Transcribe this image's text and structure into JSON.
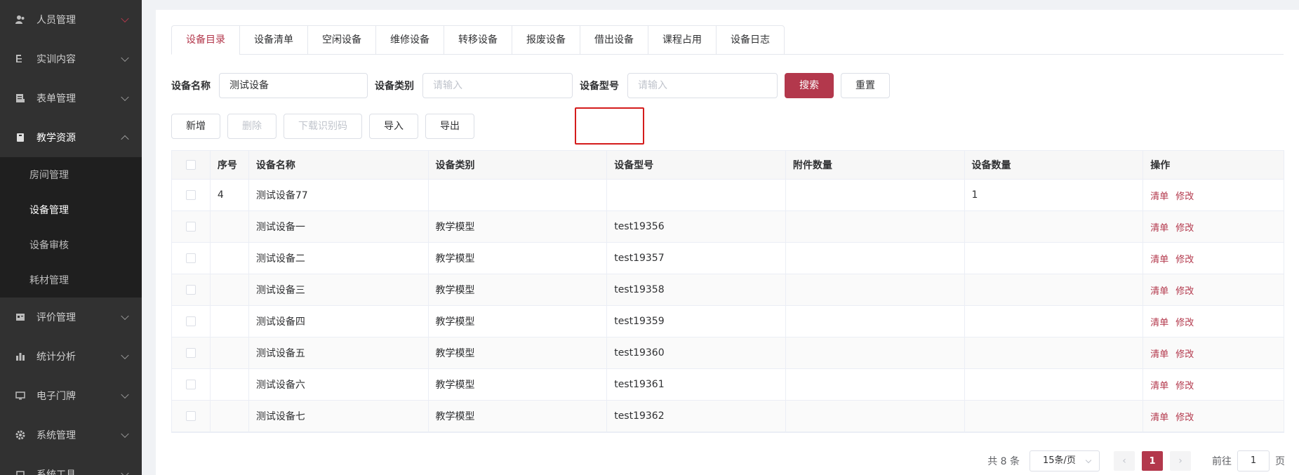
{
  "sidebar": {
    "items": [
      {
        "label": "人员管理",
        "icon": "users-icon"
      },
      {
        "label": "实训内容",
        "icon": "list-icon"
      },
      {
        "label": "表单管理",
        "icon": "form-icon"
      },
      {
        "label": "教学资源",
        "icon": "book-icon"
      },
      {
        "label": "评价管理",
        "icon": "evaluation-icon"
      },
      {
        "label": "统计分析",
        "icon": "bar-chart-icon"
      },
      {
        "label": "电子门牌",
        "icon": "monitor-icon"
      },
      {
        "label": "系统管理",
        "icon": "gear-icon"
      },
      {
        "label": "系统工具",
        "icon": "tool-icon"
      }
    ],
    "submenu": [
      "房间管理",
      "设备管理",
      "设备审核",
      "耗材管理"
    ]
  },
  "tabs": [
    "设备目录",
    "设备清单",
    "空闲设备",
    "维修设备",
    "转移设备",
    "报废设备",
    "借出设备",
    "课程占用",
    "设备日志"
  ],
  "search": {
    "name_label": "设备名称",
    "name_value": "测试设备",
    "type_label": "设备类别",
    "type_placeholder": "请输入",
    "model_label": "设备型号",
    "model_placeholder": "请输入",
    "search_btn": "搜索",
    "reset_btn": "重置"
  },
  "toolbar": {
    "add": "新增",
    "delete": "删除",
    "download_code": "下载识别码",
    "import": "导入",
    "export": "导出"
  },
  "table": {
    "headers": [
      "序号",
      "设备名称",
      "设备类别",
      "设备型号",
      "附件数量",
      "设备数量",
      "操作"
    ],
    "rows": [
      {
        "no": "4",
        "name": "测试设备77",
        "type": "",
        "model": "",
        "acc": "",
        "qty": "1"
      },
      {
        "no": "",
        "name": "测试设备一",
        "type": "教学模型",
        "model": "test19356",
        "acc": "",
        "qty": ""
      },
      {
        "no": "",
        "name": "测试设备二",
        "type": "教学模型",
        "model": "test19357",
        "acc": "",
        "qty": ""
      },
      {
        "no": "",
        "name": "测试设备三",
        "type": "教学模型",
        "model": "test19358",
        "acc": "",
        "qty": ""
      },
      {
        "no": "",
        "name": "测试设备四",
        "type": "教学模型",
        "model": "test19359",
        "acc": "",
        "qty": ""
      },
      {
        "no": "",
        "name": "测试设备五",
        "type": "教学模型",
        "model": "test19360",
        "acc": "",
        "qty": ""
      },
      {
        "no": "",
        "name": "测试设备六",
        "type": "教学模型",
        "model": "test19361",
        "acc": "",
        "qty": ""
      },
      {
        "no": "",
        "name": "测试设备七",
        "type": "教学模型",
        "model": "test19362",
        "acc": "",
        "qty": ""
      }
    ],
    "op_list": "清单",
    "op_edit": "修改"
  },
  "pager": {
    "total": "共 8 条",
    "page_size": "15条/页",
    "current": "1",
    "goto_prefix": "前往",
    "goto_value": "1",
    "goto_suffix": "页",
    "prev_icon": "‹",
    "next_icon": "›"
  },
  "colors": {
    "accent": "#b3384c",
    "sidebar": "#313131",
    "highlight": "#d41c1c"
  }
}
